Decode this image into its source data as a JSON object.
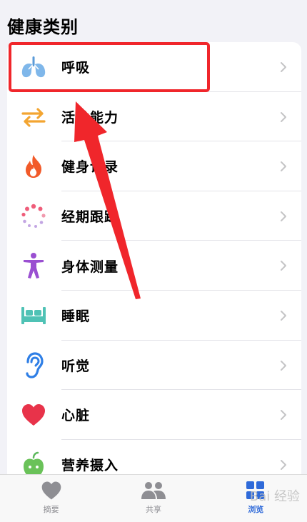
{
  "section_title": "健康类别",
  "categories": [
    {
      "label": "呼吸",
      "icon": "lungs-icon"
    },
    {
      "label": "活动能力",
      "icon": "arrows-exchange-icon"
    },
    {
      "label": "健身记录",
      "icon": "flame-icon"
    },
    {
      "label": "经期跟踪",
      "icon": "dotted-circle-icon"
    },
    {
      "label": "身体测量",
      "icon": "person-figure-icon"
    },
    {
      "label": "睡眠",
      "icon": "bed-icon"
    },
    {
      "label": "听觉",
      "icon": "ear-icon"
    },
    {
      "label": "心脏",
      "icon": "heart-icon"
    },
    {
      "label": "营养摄入",
      "icon": "apple-icon"
    }
  ],
  "tabbar": {
    "summary": "摘要",
    "sharing": "共享",
    "browse": "浏览"
  },
  "watermark": "Bai 经验",
  "colors": {
    "highlight": "#f0262b",
    "accent": "#2f6ad9"
  }
}
